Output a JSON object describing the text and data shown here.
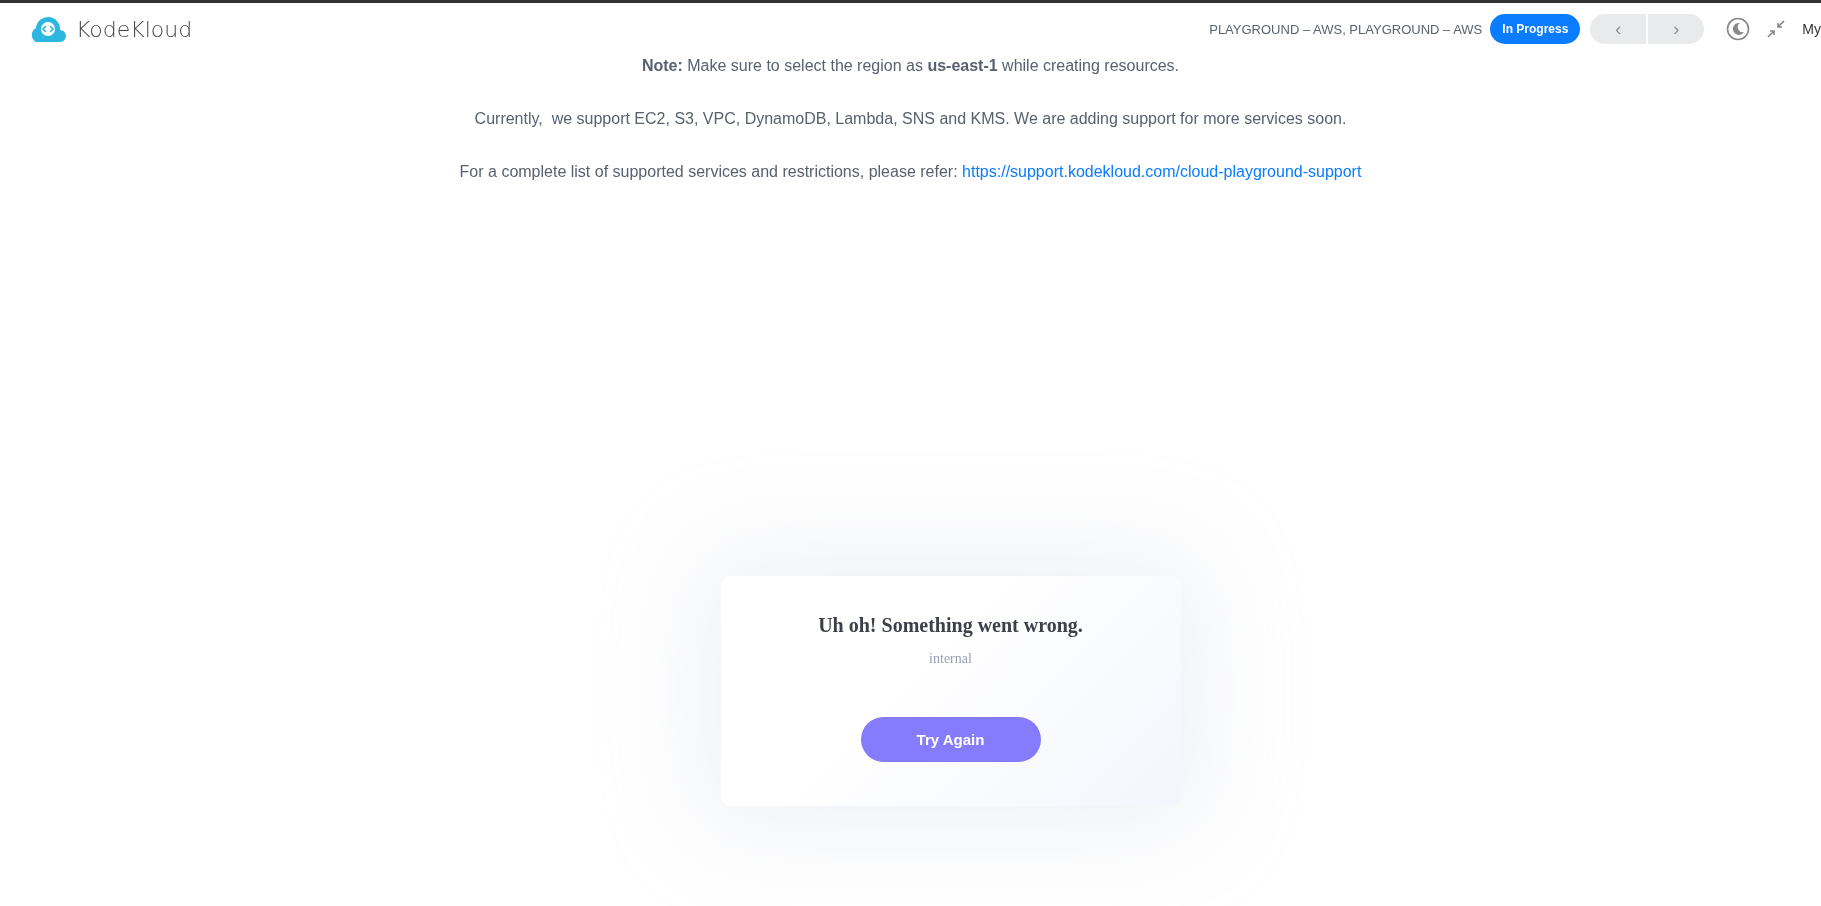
{
  "header": {
    "brand": "KodeKloud",
    "breadcrumb": "PLAYGROUND – AWS, PLAYGROUND – AWS",
    "status": "In Progress",
    "prev": {
      "label": "‹",
      "disabled": true
    },
    "next": {
      "label": "›",
      "disabled": true
    },
    "user": "My"
  },
  "notes": [
    {
      "text": "**Note:** Make sure to select the region as **us-east-1** while creating resources."
    },
    {
      "text": "Currently,  we support EC2, S3, VPC, DynamoDB, Lambda, SNS and KMS. We are adding support for more services soon."
    },
    {
      "text": "For a complete list of supported services and restrictions, please refer:",
      "link": "https://support.kodekloud.com/cloud-playground-support"
    }
  ],
  "error": {
    "title": "Uh oh! Something went wrong.",
    "message": "internal",
    "button": "Try Again"
  }
}
